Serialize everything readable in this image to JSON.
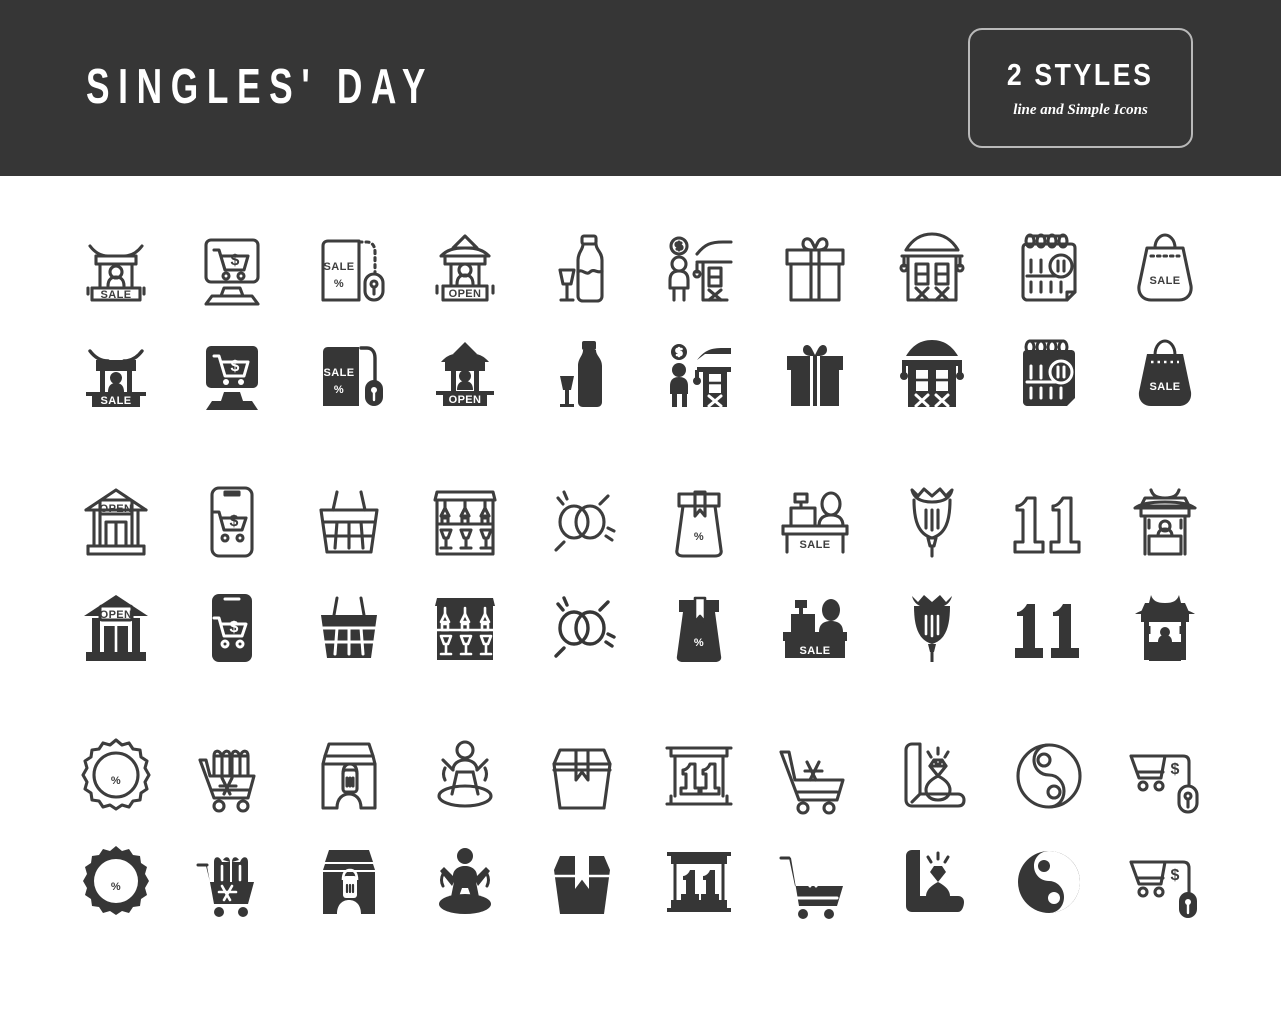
{
  "header": {
    "title": "SINGLES' DAY",
    "badge": {
      "count_label": "2 STYLES",
      "sub_label": "line and Simple Icons"
    },
    "background_color": "#363636",
    "text_color": "#ffffff"
  },
  "colors": {
    "icon_line": "#3d3d3d",
    "icon_solid": "#363636",
    "page_background": "#ffffff"
  },
  "grid": {
    "columns": 10,
    "rows": 6,
    "style_pairs": [
      {
        "line_row": 1,
        "solid_row": 2
      },
      {
        "line_row": 3,
        "solid_row": 4
      },
      {
        "line_row": 5,
        "solid_row": 6
      }
    ]
  },
  "icons": [
    {
      "id": "pagoda-sale-stall",
      "name": "pagoda-sale-stall-icon",
      "labels": [
        "SALE"
      ]
    },
    {
      "id": "desktop-online-shopping",
      "name": "desktop-online-shopping-icon",
      "labels": [
        "$"
      ]
    },
    {
      "id": "sale-percent-tag-mouse",
      "name": "sale-percent-tag-mouse-icon",
      "labels": [
        "SALE",
        "%"
      ]
    },
    {
      "id": "pagoda-open-shop",
      "name": "pagoda-open-shop-icon",
      "labels": [
        "OPEN"
      ]
    },
    {
      "id": "bottle-and-glass",
      "name": "bottle-and-glass-icon",
      "labels": []
    },
    {
      "id": "shopper-with-coin",
      "name": "shopper-with-coin-icon",
      "labels": [
        "$"
      ]
    },
    {
      "id": "gift-box",
      "name": "gift-box-icon",
      "labels": []
    },
    {
      "id": "chinese-shop-house",
      "name": "chinese-shop-house-icon",
      "labels": []
    },
    {
      "id": "calendar-eleven",
      "name": "calendar-eleven-icon",
      "labels": [
        "11"
      ]
    },
    {
      "id": "sale-shopping-bag",
      "name": "sale-shopping-bag-icon",
      "labels": [
        "SALE"
      ]
    },
    {
      "id": "store-open-sign",
      "name": "store-open-sign-icon",
      "labels": [
        "OPEN"
      ]
    },
    {
      "id": "mobile-online-shopping",
      "name": "mobile-online-shopping-icon",
      "labels": [
        "$"
      ]
    },
    {
      "id": "shopping-basket",
      "name": "shopping-basket-icon",
      "labels": []
    },
    {
      "id": "store-shelf-display",
      "name": "store-shelf-display-icon",
      "labels": []
    },
    {
      "id": "interlocking-rings",
      "name": "interlocking-rings-icon",
      "labels": []
    },
    {
      "id": "percent-gift-bag",
      "name": "percent-gift-bag-icon",
      "labels": [
        "%"
      ]
    },
    {
      "id": "cashier-sale-counter",
      "name": "cashier-sale-counter-icon",
      "labels": [
        "SALE"
      ]
    },
    {
      "id": "chinese-lantern",
      "name": "chinese-lantern-icon",
      "labels": []
    },
    {
      "id": "number-eleven",
      "name": "number-eleven-icon",
      "labels": [
        "11"
      ]
    },
    {
      "id": "pagoda-market-stall",
      "name": "pagoda-market-stall-icon",
      "labels": []
    },
    {
      "id": "percent-discount-badge",
      "name": "percent-discount-badge-icon",
      "labels": [
        "%"
      ]
    },
    {
      "id": "cart-with-gifts",
      "name": "cart-with-gifts-icon",
      "labels": []
    },
    {
      "id": "shop-with-price-tag",
      "name": "shop-with-price-tag-icon",
      "labels": []
    },
    {
      "id": "celebrating-person",
      "name": "celebrating-person-icon",
      "labels": []
    },
    {
      "id": "delivery-box-ribbon",
      "name": "delivery-box-ribbon-icon",
      "labels": []
    },
    {
      "id": "eleven-scroll-banner",
      "name": "eleven-scroll-banner-icon",
      "labels": [
        "11"
      ]
    },
    {
      "id": "shopping-cart",
      "name": "shopping-cart-icon",
      "labels": []
    },
    {
      "id": "diamond-ring-box",
      "name": "diamond-ring-box-icon",
      "labels": []
    },
    {
      "id": "yin-yang",
      "name": "yin-yang-icon",
      "labels": []
    },
    {
      "id": "cart-dollar-tag-mouse",
      "name": "cart-dollar-tag-mouse-icon",
      "labels": [
        "$"
      ]
    }
  ],
  "labels": {
    "sale": "SALE",
    "open": "OPEN",
    "percent": "%",
    "dollar": "$",
    "eleven": "11"
  }
}
